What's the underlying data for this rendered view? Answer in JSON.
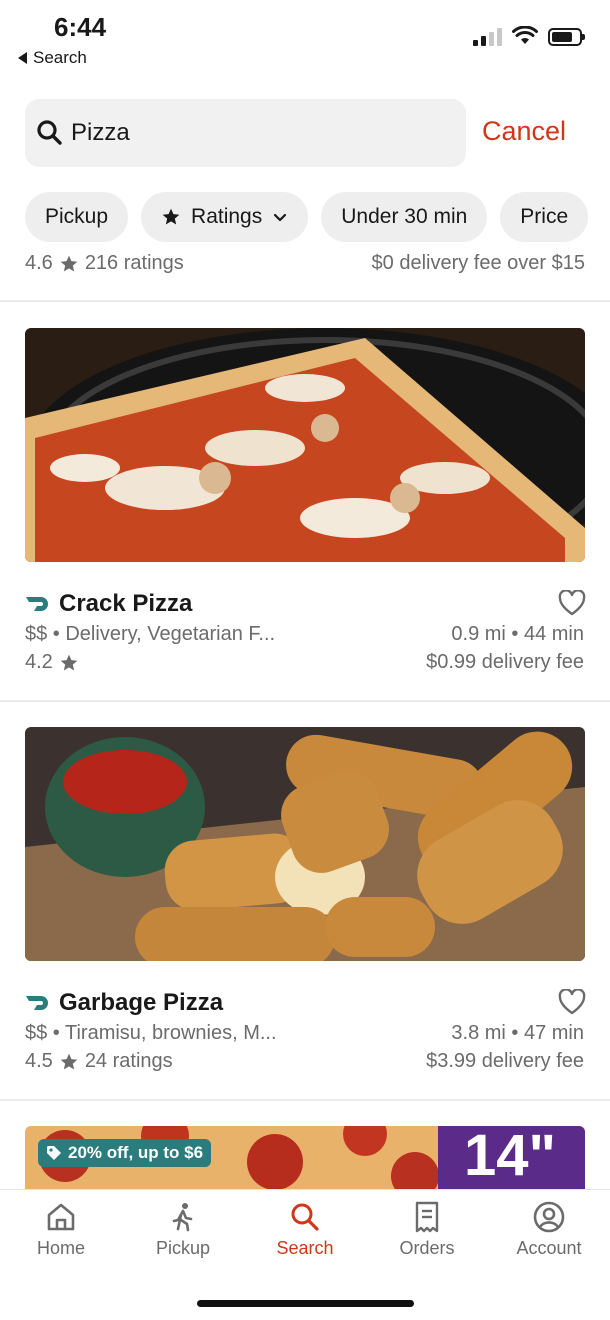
{
  "status_bar": {
    "time": "6:44",
    "back_label": "Search"
  },
  "search": {
    "value": "Pizza",
    "placeholder": "",
    "cancel_label": "Cancel"
  },
  "chips": [
    {
      "label": "Pickup"
    },
    {
      "label": "Ratings"
    },
    {
      "label": "Under 30 min"
    },
    {
      "label": "Price"
    }
  ],
  "partial_store": {
    "rating": "4.6",
    "ratings_count": "216 ratings",
    "fee": "$0 delivery fee over $15"
  },
  "stores": [
    {
      "name": "Crack Pizza",
      "description": "$$ • Delivery, Vegetarian F...",
      "rating": "4.2",
      "ratings_count": "",
      "distance_time": "0.9 mi • 44 min",
      "fee": "$0.99 delivery fee"
    },
    {
      "name": "Garbage Pizza",
      "description": "$$ • Tiramisu, brownies, M...",
      "rating": "4.5",
      "ratings_count": "24 ratings",
      "distance_time": "3.8 mi • 47 min",
      "fee": "$3.99 delivery fee"
    }
  ],
  "promo": {
    "badge": "20% off, up to $6",
    "size_text": "14\""
  },
  "bottom_nav": [
    {
      "label": "Home",
      "icon": "home-icon"
    },
    {
      "label": "Pickup",
      "icon": "walking-person-icon"
    },
    {
      "label": "Search",
      "icon": "search-icon"
    },
    {
      "label": "Orders",
      "icon": "receipt-icon"
    },
    {
      "label": "Account",
      "icon": "account-icon"
    }
  ],
  "colors": {
    "accent": "#d0361a",
    "dashpass": "#2b7c7c",
    "muted": "#6b6b6b"
  }
}
